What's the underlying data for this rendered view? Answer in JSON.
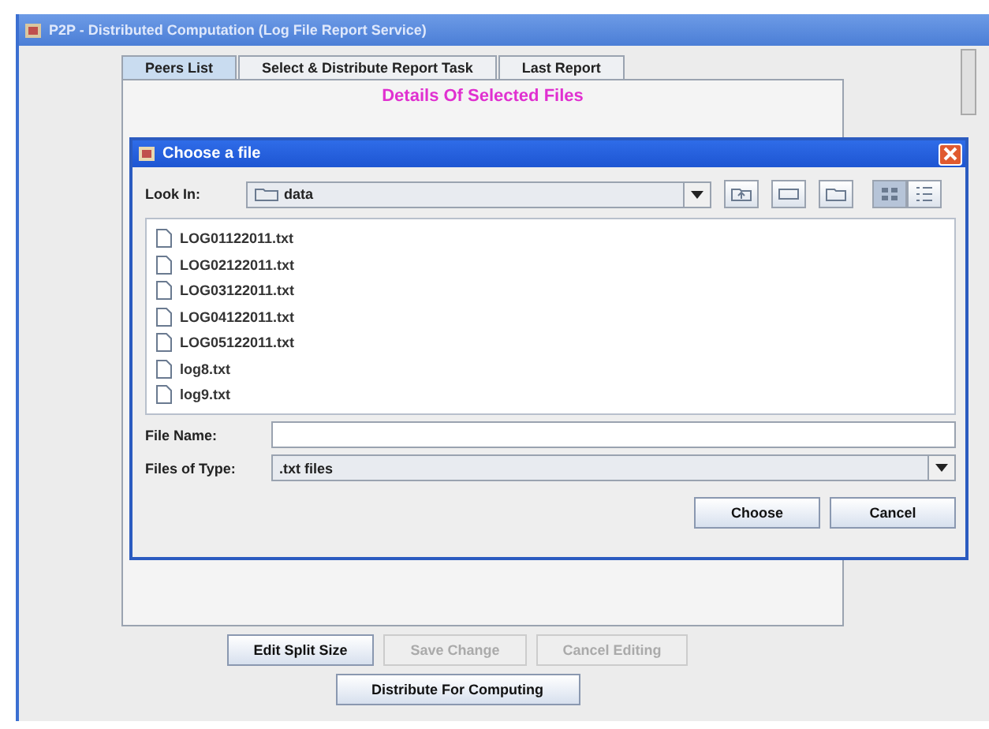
{
  "window": {
    "title": "P2P - Distributed Computation (Log File Report Service)"
  },
  "tabs": [
    {
      "label": "Peers List",
      "selected": true
    },
    {
      "label": "Select & Distribute Report Task",
      "selected": false
    },
    {
      "label": "Last Report",
      "selected": false
    }
  ],
  "panel": {
    "heading": "Details Of Selected Files"
  },
  "buttons": [
    {
      "label": "Edit Split Size",
      "disabled": false
    },
    {
      "label": "Save Change",
      "disabled": true
    },
    {
      "label": "Cancel Editing",
      "disabled": true
    },
    {
      "label": "Distribute For Computing",
      "disabled": false
    }
  ],
  "dialog": {
    "title": "Choose a file",
    "look_in_label": "Look In:",
    "look_in_value": "data",
    "files": [
      "LOG01122011.txt",
      "LOG02122011.txt",
      "LOG03122011.txt",
      "LOG04122011.txt",
      "LOG05122011.txt",
      "log8.txt",
      "log9.txt"
    ],
    "file_name_label": "File Name:",
    "file_type_label": "Files of Type:",
    "file_type_value": ".txt files",
    "buttons": [
      "Choose",
      "Cancel"
    ]
  }
}
